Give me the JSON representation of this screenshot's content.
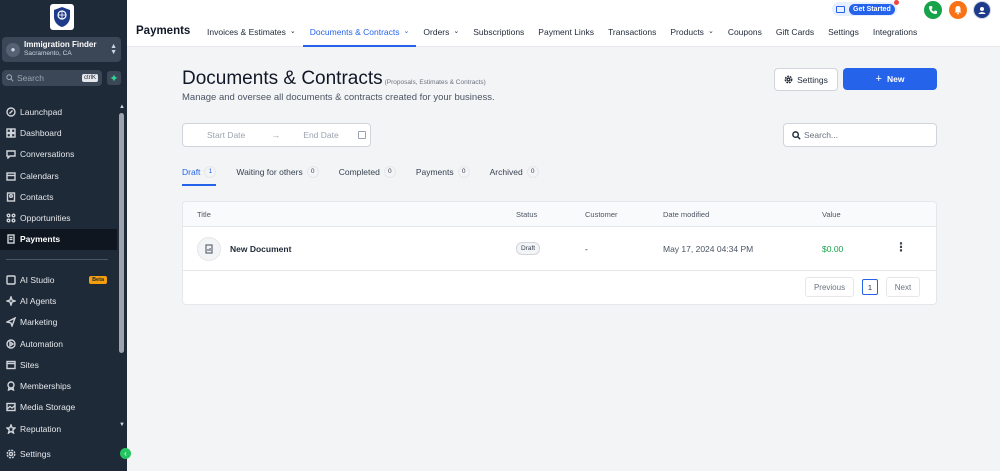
{
  "sidebar": {
    "account": {
      "name": "Immigration Finder",
      "location": "Sacramento, CA"
    },
    "search": {
      "placeholder": "Search",
      "shortcut": "ctrlK"
    },
    "items": [
      {
        "label": "Launchpad",
        "icon": "rocket-icon"
      },
      {
        "label": "Dashboard",
        "icon": "dashboard-icon"
      },
      {
        "label": "Conversations",
        "icon": "chat-icon"
      },
      {
        "label": "Calendars",
        "icon": "calendar-icon"
      },
      {
        "label": "Contacts",
        "icon": "contacts-icon"
      },
      {
        "label": "Opportunities",
        "icon": "opportunities-icon"
      },
      {
        "label": "Payments",
        "icon": "payments-icon",
        "active": true
      }
    ],
    "items2": [
      {
        "label": "AI Studio",
        "icon": "ai-studio-icon",
        "badge": "Beta"
      },
      {
        "label": "AI Agents",
        "icon": "sparkle-icon"
      },
      {
        "label": "Marketing",
        "icon": "send-icon"
      },
      {
        "label": "Automation",
        "icon": "automation-icon"
      },
      {
        "label": "Sites",
        "icon": "sites-icon"
      },
      {
        "label": "Memberships",
        "icon": "memberships-icon"
      },
      {
        "label": "Media Storage",
        "icon": "media-icon"
      },
      {
        "label": "Reputation",
        "icon": "star-icon"
      }
    ],
    "settings_label": "Settings"
  },
  "topbar": {
    "title": "Payments",
    "tabs": [
      {
        "label": "Invoices & Estimates",
        "dropdown": true
      },
      {
        "label": "Documents & Contracts",
        "dropdown": true,
        "active": true
      },
      {
        "label": "Orders",
        "dropdown": true
      },
      {
        "label": "Subscriptions"
      },
      {
        "label": "Payment Links"
      },
      {
        "label": "Transactions"
      },
      {
        "label": "Products",
        "dropdown": true
      },
      {
        "label": "Coupons"
      },
      {
        "label": "Gift Cards"
      },
      {
        "label": "Settings"
      },
      {
        "label": "Integrations"
      }
    ],
    "get_started": "Get Started",
    "colors": {
      "phone": "#16a34a",
      "bell": "#f97316",
      "avatar": "#1e3a8a"
    }
  },
  "main": {
    "title": "Documents & Contracts",
    "title_note": "(Proposals, Estimates & Contracts)",
    "subtitle": "Manage and oversee all documents & contracts created for your business.",
    "settings_button": "Settings",
    "new_button": "New",
    "date_range": {
      "start_placeholder": "Start Date",
      "end_placeholder": "End Date"
    },
    "search_placeholder": "Search...",
    "subtabs": [
      {
        "label": "Draft",
        "count": "1",
        "active": true
      },
      {
        "label": "Waiting for others",
        "count": "0"
      },
      {
        "label": "Completed",
        "count": "0"
      },
      {
        "label": "Payments",
        "count": "0"
      },
      {
        "label": "Archived",
        "count": "0"
      }
    ],
    "table": {
      "columns": [
        "Title",
        "Status",
        "Customer",
        "Date modified",
        "Value"
      ],
      "rows": [
        {
          "title": "New Document",
          "status": "Draft",
          "customer": "-",
          "date_modified": "May 17, 2024 04:34 PM",
          "value": "$0.00"
        }
      ]
    },
    "pagination": {
      "previous": "Previous",
      "page": "1",
      "next": "Next"
    }
  }
}
